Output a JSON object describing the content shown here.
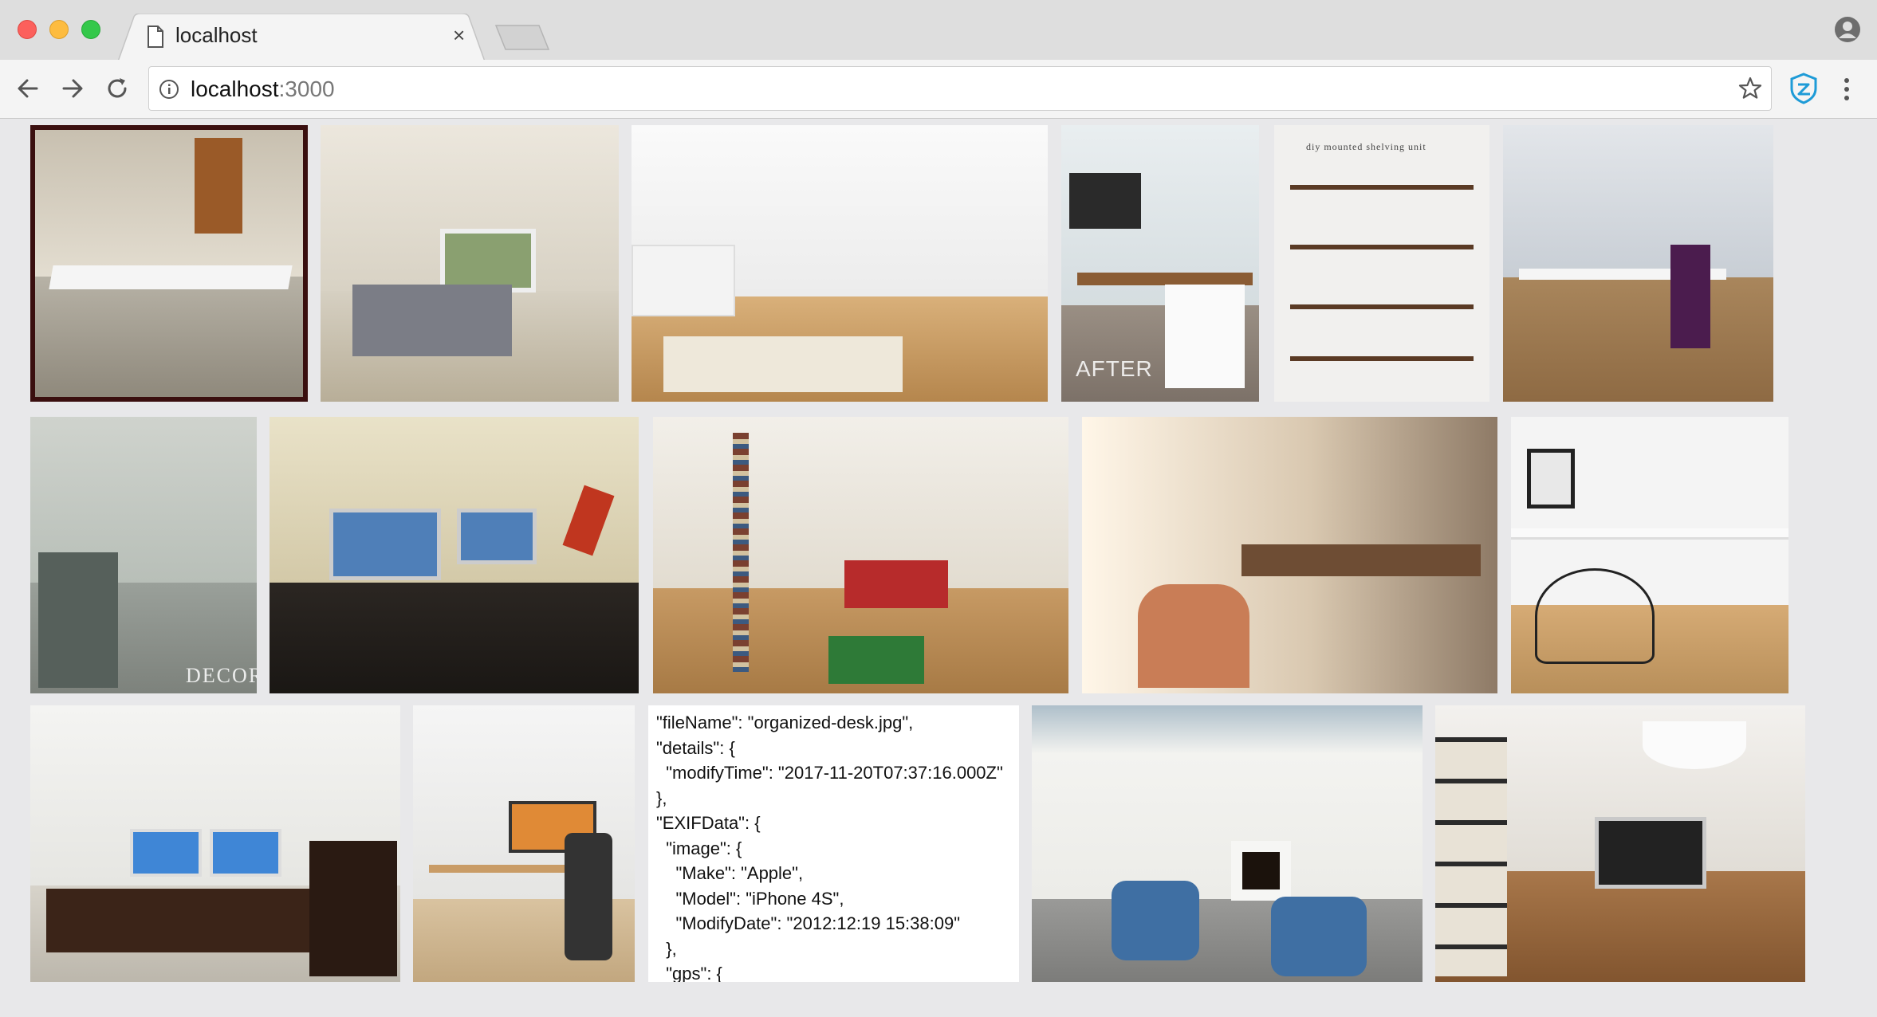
{
  "browser": {
    "tab_title": "localhost",
    "tab_close": "×",
    "url_host": "localhost",
    "url_port": ":3000"
  },
  "gallery": {
    "captions": {
      "after_label": "AFTER",
      "shelf_caption": "diy mounted shelving unit",
      "decor_watermark": "DECOR"
    },
    "metadata_json": "\"fileName\": \"organized-desk.jpg\",\n\"details\": {\n  \"modifyTime\": \"2017-11-20T07:37:16.000Z\"\n},\n\"EXIFData\": {\n  \"image\": {\n    \"Make\": \"Apple\",\n    \"Model\": \"iPhone 4S\",\n    \"ModifyDate\": \"2012:12:19 15:38:09\"\n  },\n  \"gps\": {"
  },
  "colors": {
    "close": "#fc605c",
    "minimize": "#fdbc40",
    "maximize": "#34c84a",
    "extension_accent": "#1e9bd7"
  }
}
